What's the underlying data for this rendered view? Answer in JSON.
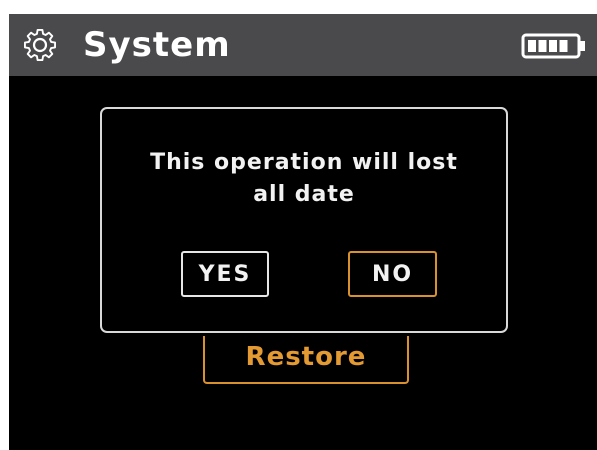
{
  "header": {
    "title": "System",
    "left_icon": "gear-icon",
    "right_icon": "battery-full-icon",
    "background_color": "#4a4a4c"
  },
  "background": {
    "restore_label": "Restore"
  },
  "dialog": {
    "message_line1": "This operation will lost",
    "message_line2": "all date",
    "yes_label": "YES",
    "no_label": "NO"
  },
  "colors": {
    "accent": "#d9902e",
    "text": "#f2f2f2",
    "screen_background": "#000000"
  }
}
